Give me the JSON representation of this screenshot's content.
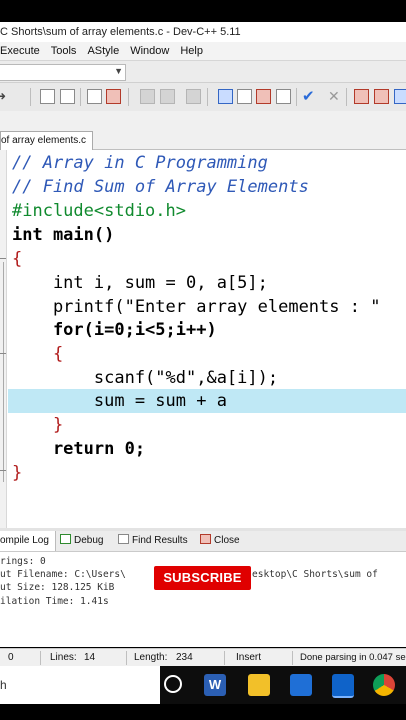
{
  "window": {
    "title": "C Shorts\\sum of array elements.c - Dev-C++ 5.11"
  },
  "menu": {
    "items": [
      "Execute",
      "Tools",
      "AStyle",
      "Window",
      "Help"
    ]
  },
  "editor": {
    "tab_label": "of array elements.c",
    "lines": [
      "// Array in C Programming",
      "// Find Sum of Array Elements",
      "#include<stdio.h>",
      "int main()",
      "{",
      "    int i, sum = 0, a[5];",
      "    printf(\"Enter array elements : \"",
      "    for(i=0;i<5;i++)",
      "    {",
      "        scanf(\"%d\",&a[i]);",
      "        sum = sum + a",
      "    }",
      "    return 0;",
      "}"
    ]
  },
  "bottom_tabs": {
    "compile_log": "ompile Log",
    "debug": "Debug",
    "find_results": "Find Results",
    "close": "Close"
  },
  "compile_log": {
    "lines": [
      "rings: 0",
      "ut Filename: C:\\Users\\",
      "ut Size: 128.125 KiB",
      "ilation Time: 1.41s"
    ],
    "filename_tail": "esktop\\C Shorts\\sum of"
  },
  "overlay": {
    "subscribe": "SUBSCRIBE"
  },
  "status": {
    "col": "0",
    "lines_label": "Lines:",
    "lines_value": "14",
    "length_label": "Length:",
    "length_value": "234",
    "mode": "Insert",
    "message": "Done parsing in 0.047 se"
  },
  "taskbar": {
    "icons": [
      "search-circle-icon",
      "word-icon",
      "file-explorer-icon",
      "devcpp-icon",
      "outlook-icon",
      "chrome-icon"
    ]
  },
  "colors": {
    "comment": "#2f59b7",
    "preprocessor": "#108a2e",
    "string": "#c81e1e",
    "number": "#8b1a9c",
    "current_line": "#bfe8f5",
    "subscribe_bg": "#e00000"
  }
}
